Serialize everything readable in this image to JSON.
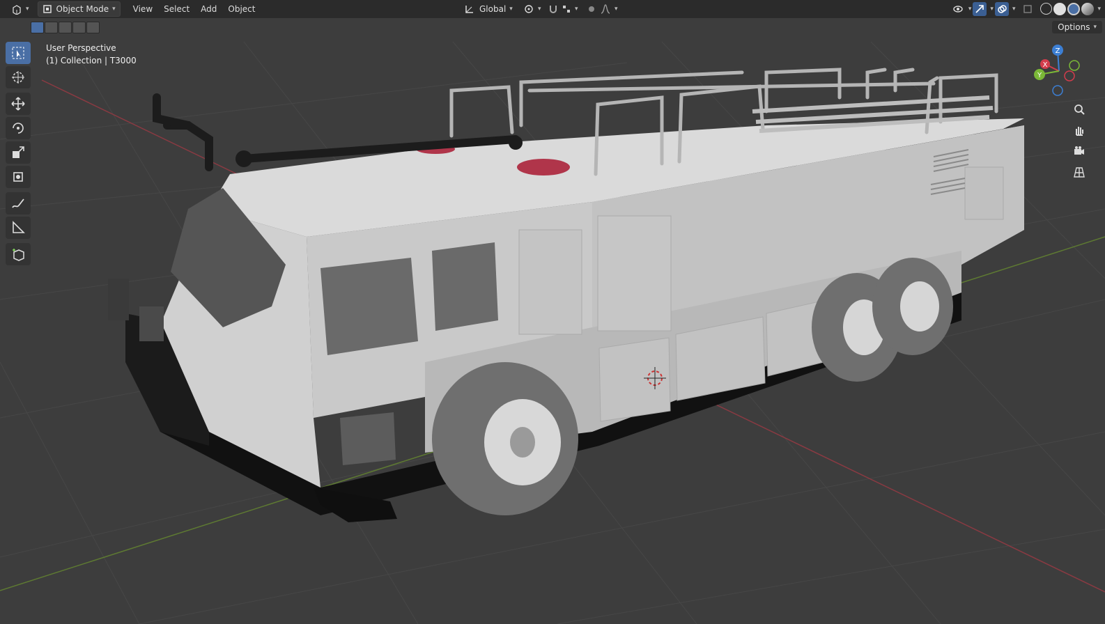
{
  "header": {
    "editor_type_icon": "3d-viewport-icon",
    "mode_label": "Object Mode",
    "menus": [
      "View",
      "Select",
      "Add",
      "Object"
    ],
    "transform_orientation": "Global"
  },
  "viewport": {
    "perspective_label": "User Perspective",
    "collection_label": "(1) Collection | T3000",
    "options_label": "Options"
  },
  "gizmo": {
    "axes": [
      "Z",
      "X",
      "Y"
    ],
    "colors": {
      "x": "#d23c4c",
      "y": "#7bb837",
      "z": "#3c7fd4"
    }
  },
  "toolbar": {
    "tools": [
      "select-box-icon",
      "cursor-icon",
      "move-icon",
      "rotate-icon",
      "scale-icon",
      "transform-icon",
      "annotate-icon",
      "measure-icon",
      "add-cube-icon"
    ]
  },
  "colors": {
    "background": "#3d3d3d",
    "header": "#2b2b2b",
    "accent": "#4a6fa5",
    "grid": "#474747"
  }
}
